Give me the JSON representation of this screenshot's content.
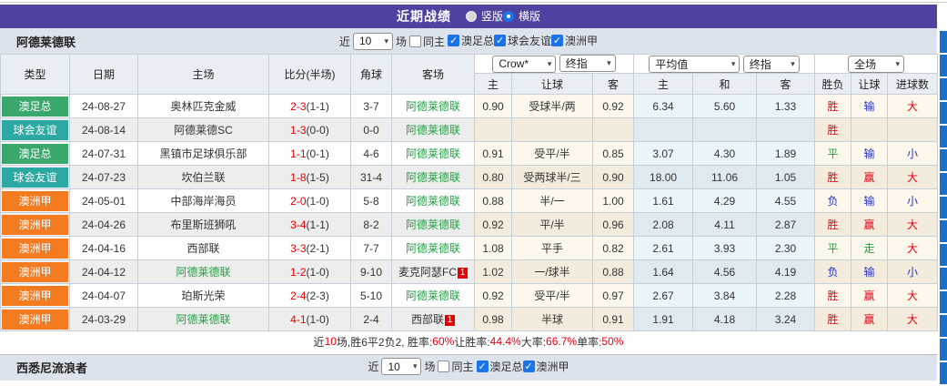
{
  "colors": {
    "purple": "#4d42a0",
    "controls_bg": "#dde3ec",
    "head_bg": "#e9eef4",
    "border": "#c6d0da",
    "league_green": "#3aa86c",
    "league_teal": "#2ba9a2",
    "league_orange": "#f57b20",
    "team_green": "#22a043",
    "score_red": "#e60000",
    "red": "#e60012",
    "blue": "#2330cc",
    "green": "#1f9e40",
    "check_blue": "#1a73e8",
    "odds_bg": "#fdf8eb",
    "odds_bg_alt": "#f3ecdc",
    "avg_bg": "#eaf4fb",
    "avg_bg_alt": "#dfe9f0",
    "strip_blue": "#1b6fc6"
  },
  "header": {
    "title": "近期战绩",
    "layout_options": [
      {
        "label": "竖版",
        "selected": false
      },
      {
        "label": "横版",
        "selected": true
      }
    ]
  },
  "controls": {
    "team": "阿德莱德联",
    "near_label": "近",
    "matches_count": "10",
    "field_label": "场",
    "same_home_label": "同主",
    "same_home_checked": false,
    "filters": [
      {
        "label": "澳足总",
        "checked": true
      },
      {
        "label": "球会友谊",
        "checked": true
      },
      {
        "label": "澳洲甲",
        "checked": true
      }
    ]
  },
  "table": {
    "selects": {
      "bookmaker": "Crow*",
      "bookmaker_index": "终指",
      "average": "平均值",
      "average_index": "终指",
      "scope": "全场"
    },
    "main_headers": [
      "类型",
      "日期",
      "主场",
      "比分(半场)",
      "角球",
      "客场"
    ],
    "sub_headers": [
      "主",
      "让球",
      "客",
      "主",
      "和",
      "客",
      "胜负",
      "让球",
      "进球数"
    ],
    "rows": [
      {
        "league": "澳足总",
        "league_color": "green",
        "date": "24-08-27",
        "home": "奥林匹克金威",
        "home_self": false,
        "home_badge": "",
        "score": "2-3",
        "half": "(1-1)",
        "corner": "3-7",
        "away": "阿德莱德联",
        "away_self": true,
        "away_badge": "",
        "odds_home": "0.90",
        "handicap": "受球半/两",
        "odds_away": "0.92",
        "avg_home": "6.34",
        "avg_draw": "5.60",
        "avg_away": "1.33",
        "result": "胜",
        "result_color": "red",
        "handicap_result": "输",
        "handicap_result_color": "blue",
        "goals": "大",
        "goals_color": "red"
      },
      {
        "league": "球会友谊",
        "league_color": "teal",
        "date": "24-08-14",
        "home": "阿德莱德SC",
        "home_self": false,
        "home_badge": "",
        "score": "1-3",
        "half": "(0-0)",
        "corner": "0-0",
        "away": "阿德莱德联",
        "away_self": true,
        "away_badge": "",
        "odds_home": "",
        "handicap": "",
        "odds_away": "",
        "avg_home": "",
        "avg_draw": "",
        "avg_away": "",
        "result": "胜",
        "result_color": "red",
        "handicap_result": "",
        "handicap_result_color": "",
        "goals": "",
        "goals_color": ""
      },
      {
        "league": "澳足总",
        "league_color": "green",
        "date": "24-07-31",
        "home": "黑镇市足球俱乐部",
        "home_self": false,
        "home_badge": "",
        "score": "1-1",
        "half": "(0-1)",
        "corner": "4-6",
        "away": "阿德莱德联",
        "away_self": true,
        "away_badge": "",
        "odds_home": "0.91",
        "handicap": "受平/半",
        "odds_away": "0.85",
        "avg_home": "3.07",
        "avg_draw": "4.30",
        "avg_away": "1.89",
        "result": "平",
        "result_color": "green",
        "handicap_result": "输",
        "handicap_result_color": "blue",
        "goals": "小",
        "goals_color": "blue"
      },
      {
        "league": "球会友谊",
        "league_color": "teal",
        "date": "24-07-23",
        "home": "坎伯兰联",
        "home_self": false,
        "home_badge": "",
        "score": "1-8",
        "half": "(1-5)",
        "corner": "31-4",
        "away": "阿德莱德联",
        "away_self": true,
        "away_badge": "",
        "odds_home": "0.80",
        "handicap": "受两球半/三",
        "odds_away": "0.90",
        "avg_home": "18.00",
        "avg_draw": "11.06",
        "avg_away": "1.05",
        "result": "胜",
        "result_color": "red",
        "handicap_result": "赢",
        "handicap_result_color": "red",
        "goals": "大",
        "goals_color": "red"
      },
      {
        "league": "澳洲甲",
        "league_color": "orange",
        "date": "24-05-01",
        "home": "中部海岸海员",
        "home_self": false,
        "home_badge": "",
        "score": "2-0",
        "half": "(1-0)",
        "corner": "5-8",
        "away": "阿德莱德联",
        "away_self": true,
        "away_badge": "",
        "odds_home": "0.88",
        "handicap": "半/一",
        "odds_away": "1.00",
        "avg_home": "1.61",
        "avg_draw": "4.29",
        "avg_away": "4.55",
        "result": "负",
        "result_color": "blue",
        "handicap_result": "输",
        "handicap_result_color": "blue",
        "goals": "小",
        "goals_color": "blue"
      },
      {
        "league": "澳洲甲",
        "league_color": "orange",
        "date": "24-04-26",
        "home": "布里斯班狮吼",
        "home_self": false,
        "home_badge": "",
        "score": "3-4",
        "half": "(1-1)",
        "corner": "8-2",
        "away": "阿德莱德联",
        "away_self": true,
        "away_badge": "",
        "odds_home": "0.92",
        "handicap": "平/半",
        "odds_away": "0.96",
        "avg_home": "2.08",
        "avg_draw": "4.11",
        "avg_away": "2.87",
        "result": "胜",
        "result_color": "red",
        "handicap_result": "赢",
        "handicap_result_color": "red",
        "goals": "大",
        "goals_color": "red"
      },
      {
        "league": "澳洲甲",
        "league_color": "orange",
        "date": "24-04-16",
        "home": "西部联",
        "home_self": false,
        "home_badge": "",
        "score": "3-3",
        "half": "(2-1)",
        "corner": "7-7",
        "away": "阿德莱德联",
        "away_self": true,
        "away_badge": "",
        "odds_home": "1.08",
        "handicap": "平手",
        "odds_away": "0.82",
        "avg_home": "2.61",
        "avg_draw": "3.93",
        "avg_away": "2.30",
        "result": "平",
        "result_color": "green",
        "handicap_result": "走",
        "handicap_result_color": "green",
        "goals": "大",
        "goals_color": "red"
      },
      {
        "league": "澳洲甲",
        "league_color": "orange",
        "date": "24-04-12",
        "home": "阿德莱德联",
        "home_self": true,
        "home_badge": "",
        "score": "1-2",
        "half": "(1-0)",
        "corner": "9-10",
        "away": "麦克阿瑟FC",
        "away_self": false,
        "away_badge": "1",
        "odds_home": "1.02",
        "handicap": "一/球半",
        "odds_away": "0.88",
        "avg_home": "1.64",
        "avg_draw": "4.56",
        "avg_away": "4.19",
        "result": "负",
        "result_color": "blue",
        "handicap_result": "输",
        "handicap_result_color": "blue",
        "goals": "小",
        "goals_color": "blue"
      },
      {
        "league": "澳洲甲",
        "league_color": "orange",
        "date": "24-04-07",
        "home": "珀斯光荣",
        "home_self": false,
        "home_badge": "",
        "score": "2-4",
        "half": "(2-3)",
        "corner": "5-10",
        "away": "阿德莱德联",
        "away_self": true,
        "away_badge": "",
        "odds_home": "0.92",
        "handicap": "受平/半",
        "odds_away": "0.97",
        "avg_home": "2.67",
        "avg_draw": "3.84",
        "avg_away": "2.28",
        "result": "胜",
        "result_color": "red",
        "handicap_result": "赢",
        "handicap_result_color": "red",
        "goals": "大",
        "goals_color": "red"
      },
      {
        "league": "澳洲甲",
        "league_color": "orange",
        "date": "24-03-29",
        "home": "阿德莱德联",
        "home_self": true,
        "home_badge": "",
        "score": "4-1",
        "half": "(1-0)",
        "corner": "2-4",
        "away": "西部联",
        "away_self": false,
        "away_badge": "1",
        "odds_home": "0.98",
        "handicap": "半球",
        "odds_away": "0.91",
        "avg_home": "1.91",
        "avg_draw": "4.18",
        "avg_away": "3.24",
        "result": "胜",
        "result_color": "red",
        "handicap_result": "赢",
        "handicap_result_color": "red",
        "goals": "大",
        "goals_color": "red"
      }
    ]
  },
  "summary": {
    "parts": [
      {
        "t": "近",
        "c": ""
      },
      {
        "t": "10",
        "c": "red"
      },
      {
        "t": "场,胜6平2负2, 胜率:",
        "c": ""
      },
      {
        "t": "60%",
        "c": "red"
      },
      {
        "t": " 让胜率:",
        "c": ""
      },
      {
        "t": "44.4%",
        "c": "red"
      },
      {
        "t": " 大率:",
        "c": ""
      },
      {
        "t": "66.7%",
        "c": "red"
      },
      {
        "t": " 单率:",
        "c": ""
      },
      {
        "t": "50%",
        "c": "red"
      }
    ]
  },
  "next_section": {
    "team": "西悉尼流浪者",
    "near_label": "近",
    "matches_count": "10",
    "field_label": "场",
    "same_home_label": "同主",
    "same_home_checked": false,
    "filters": [
      {
        "label": "澳足总",
        "checked": true
      },
      {
        "label": "澳洲甲",
        "checked": true
      }
    ]
  },
  "strip": {
    "block_count": 15
  }
}
